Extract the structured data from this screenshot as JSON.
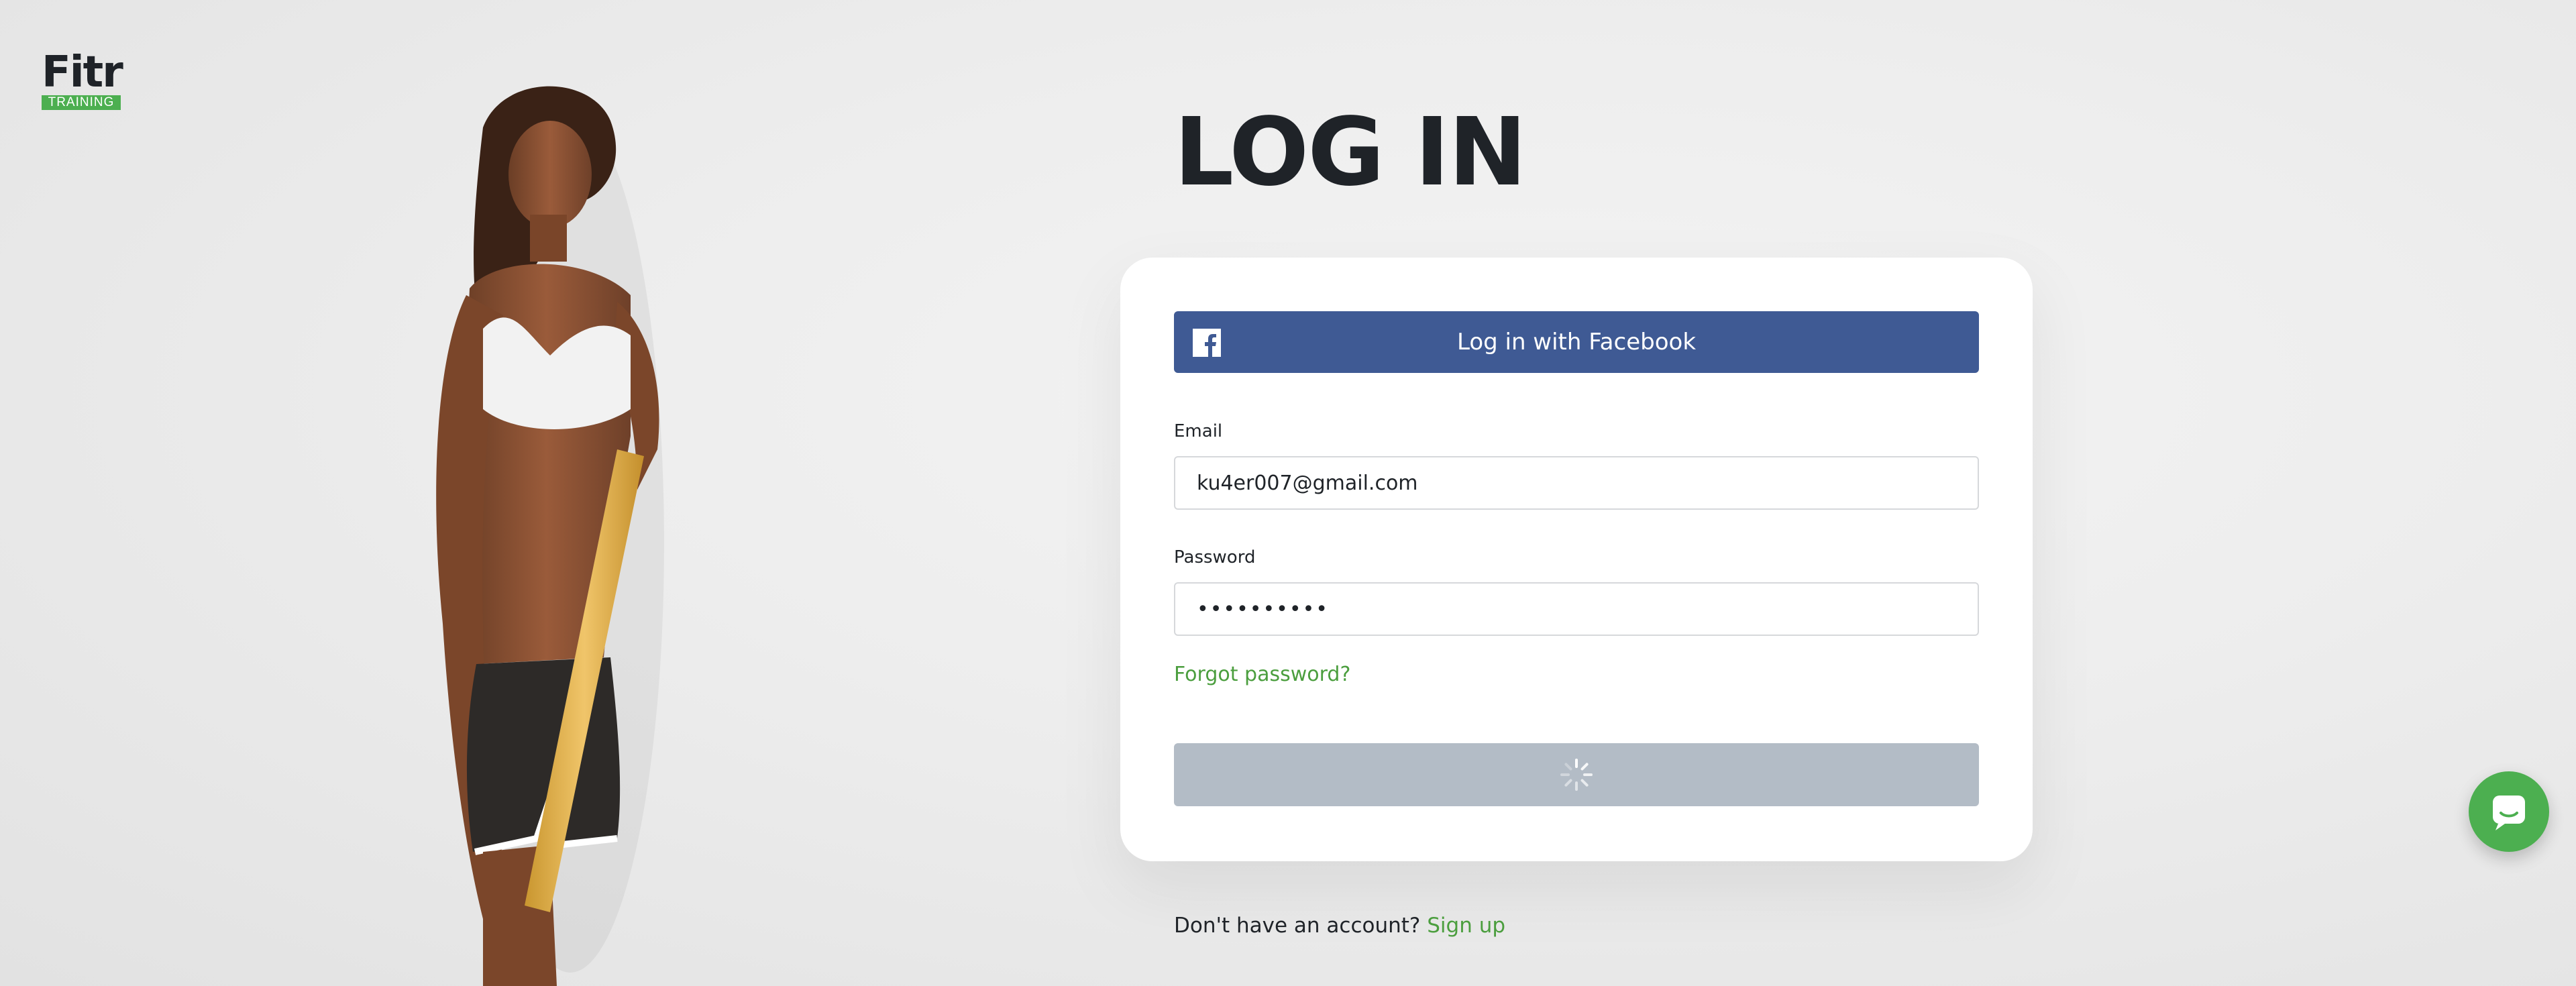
{
  "brand": {
    "name": "Fitr",
    "tagline": "TRAINING",
    "accent": "#4caf50"
  },
  "page": {
    "title": "LOG IN"
  },
  "facebook": {
    "label": "Log in with Facebook",
    "icon": "facebook-icon",
    "color": "#3f5a94"
  },
  "form": {
    "email_label": "Email",
    "email_value": "ku4er007@gmail.com",
    "password_label": "Password",
    "password_value": "••••••••••",
    "forgot_label": "Forgot password?",
    "submit_state": "loading",
    "submit_icon": "spinner-icon"
  },
  "signup": {
    "prompt": "Don't have an account?",
    "link": "Sign up"
  },
  "chat": {
    "icon": "chat-icon"
  }
}
